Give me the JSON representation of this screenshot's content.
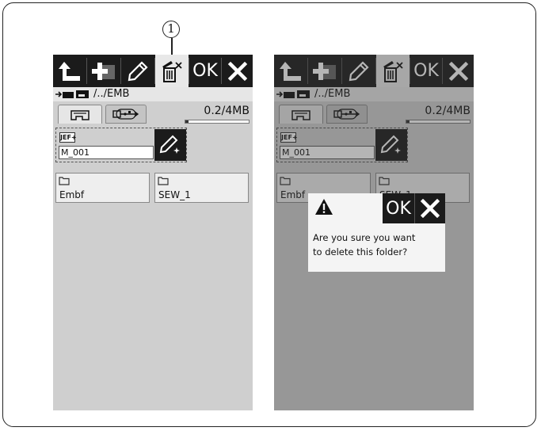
{
  "callout": {
    "number": "1"
  },
  "toolbar": {
    "ok_label": "OK"
  },
  "path": {
    "text": "/../EMB"
  },
  "memory": {
    "usage_text": "0.2/4MB",
    "used_fraction": 0.05
  },
  "selected_file": {
    "format_badge": "JEF+",
    "name": "M_001"
  },
  "folders": [
    {
      "name": "Embf"
    },
    {
      "name": "SEW_1"
    }
  ],
  "dialog": {
    "ok_label": "OK",
    "message_line1": "Are you sure you want",
    "message_line2": "to delete this folder?"
  },
  "icons": {
    "back": "return-arrow-icon",
    "new_folder": "new-folder-icon",
    "rename": "pencil-icon",
    "delete": "trash-icon",
    "cancel": "close-icon",
    "machine_tab": "machine-memory-icon",
    "usb_tab": "usb-icon",
    "warning": "warning-icon"
  },
  "colors": {
    "toolbar_bg": "#1b1b1b",
    "screen_bg": "#cfcfcf",
    "active_button_bg": "#e8e8e8"
  }
}
